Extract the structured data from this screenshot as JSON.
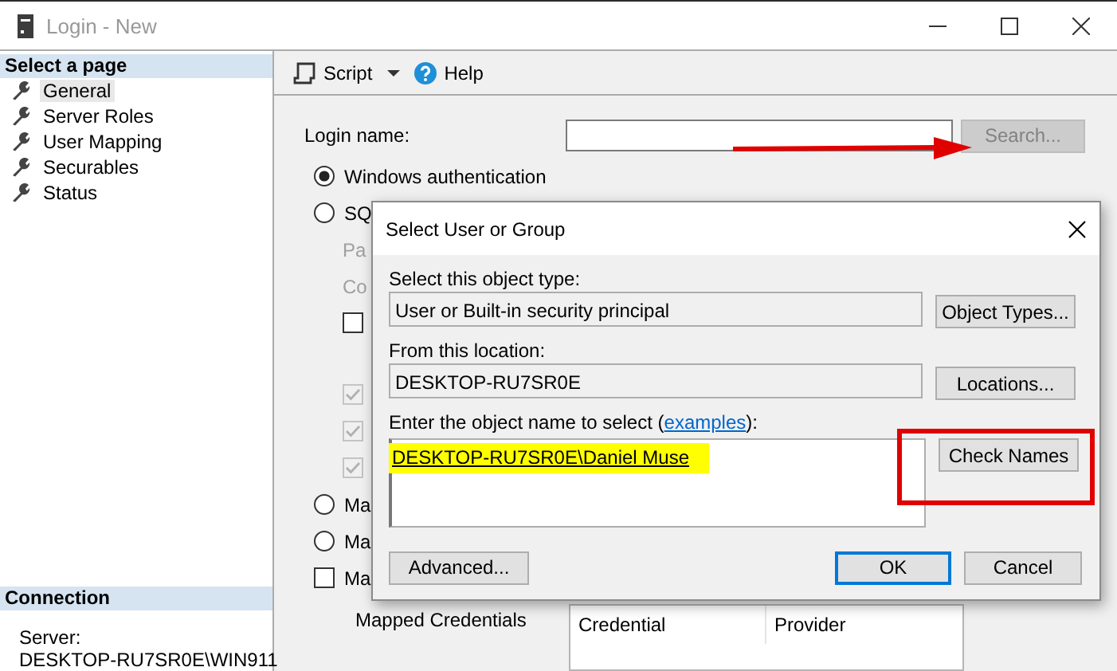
{
  "window": {
    "title": "Login - New"
  },
  "sidebar": {
    "header": "Select a page",
    "items": [
      {
        "label": "General",
        "selected": true
      },
      {
        "label": "Server Roles",
        "selected": false
      },
      {
        "label": "User Mapping",
        "selected": false
      },
      {
        "label": "Securables",
        "selected": false
      },
      {
        "label": "Status",
        "selected": false
      }
    ]
  },
  "connection": {
    "header": "Connection",
    "server_label": "Server:",
    "server": "DESKTOP-RU7SR0E\\WIN911"
  },
  "toolbar": {
    "script": "Script",
    "help": "Help"
  },
  "form": {
    "login_label": "Login name:",
    "search_button": {
      "label": "Search...",
      "disabled": true
    },
    "options": [
      {
        "kind": "radio",
        "label": "Windows authentication",
        "selected": true
      },
      {
        "kind": "radio",
        "label": "SQ",
        "selected": false
      },
      {
        "kind": "text",
        "label": "Pa",
        "disabled": true
      },
      {
        "kind": "text",
        "label": "Co",
        "disabled": true
      },
      {
        "kind": "checkbox",
        "checked": false,
        "disabled": false
      },
      {
        "kind": "checkbox",
        "checked": true,
        "disabled": true
      },
      {
        "kind": "checkbox",
        "checked": true,
        "disabled": true
      },
      {
        "kind": "checkbox",
        "checked": true,
        "disabled": true
      },
      {
        "kind": "radio",
        "label": "Ma",
        "selected": false
      },
      {
        "kind": "radio",
        "label": "Ma",
        "selected": false
      },
      {
        "kind": "checkbox",
        "label": "Ma",
        "checked": false,
        "disabled": false
      }
    ],
    "mapped_credentials": {
      "label": "Mapped Credentials",
      "columns": [
        "Credential",
        "Provider"
      ]
    }
  },
  "dialog": {
    "title": "Select User or Group",
    "object_type_label": "Select this object type:",
    "object_type": "User or Built-in security principal",
    "object_types_button": "Object Types...",
    "location_label": "From this location:",
    "location": "DESKTOP-RU7SR0E",
    "locations_button": "Locations...",
    "names_label": {
      "before": "Enter the object name to select (",
      "link": "examples",
      "after": "):"
    },
    "names": [
      {
        "text": "DESKTOP-RU7SR0E\\Daniel Muse",
        "resolved": true,
        "highlighted": true
      }
    ],
    "check_names_button": "Check Names",
    "advanced_button": "Advanced...",
    "ok_button": {
      "label": "OK",
      "default": true
    },
    "cancel_button": "Cancel"
  },
  "annotations": [
    {
      "kind": "arrow"
    },
    {
      "kind": "box"
    }
  ]
}
